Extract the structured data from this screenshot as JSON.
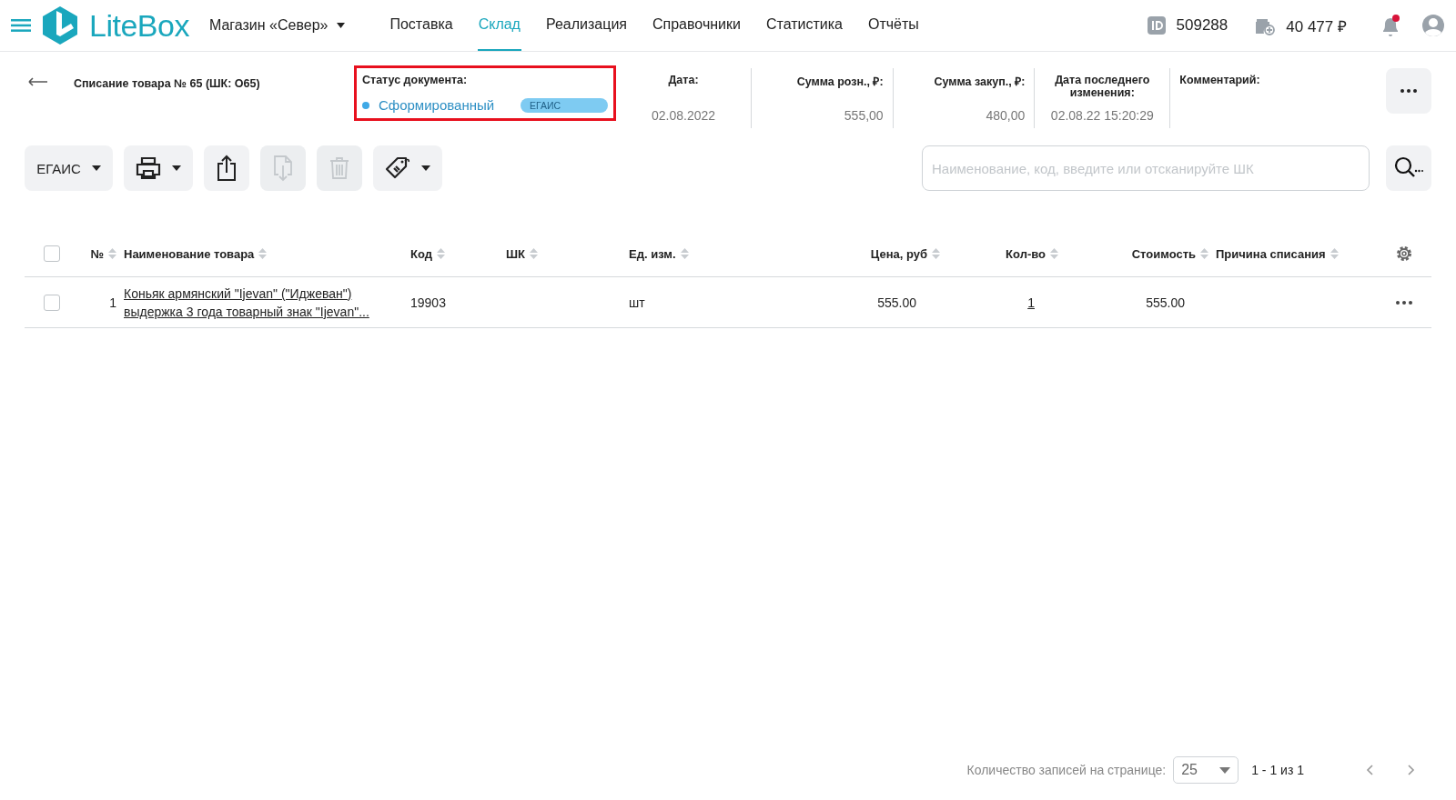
{
  "header": {
    "logo": "LiteBox",
    "store": "Магазин «Север»",
    "nav": [
      {
        "label": "Поставка",
        "selected": false
      },
      {
        "label": "Склад",
        "selected": true
      },
      {
        "label": "Реализация",
        "selected": false
      },
      {
        "label": "Справочники",
        "selected": false
      },
      {
        "label": "Статистика",
        "selected": false
      },
      {
        "label": "Отчёты",
        "selected": false
      }
    ],
    "account_id": "509288",
    "balance": "40 477 ₽",
    "has_notifications": true
  },
  "document": {
    "title": "Списание товара № 65 (ШК: О65)",
    "status_label": "Статус документа:",
    "status": "Сформированный",
    "status_tag": "ЕГАИС",
    "highlighted": true,
    "fields": [
      {
        "kind": "center",
        "label": "Дата:",
        "value": "02.08.2022"
      },
      {
        "kind": "right",
        "label": "Сумма розн., ₽:",
        "value": "555,00"
      },
      {
        "kind": "right",
        "label": "Сумма закуп., ₽:",
        "value": "480,00"
      },
      {
        "kind": "center",
        "label": "Дата последнего изменения:",
        "value": "02.08.22 15:20:29"
      },
      {
        "kind": "left",
        "label": "Комментарий:"
      }
    ]
  },
  "toolbar": {
    "menu_label": "ЕГАИС",
    "buttons": [
      {
        "kind": "print",
        "disabled": false
      },
      {
        "kind": "export",
        "disabled": false
      },
      {
        "kind": "import",
        "disabled": true
      },
      {
        "kind": "delete",
        "disabled": true
      },
      {
        "kind": "tag",
        "disabled": false
      }
    ],
    "search": {
      "placeholder": "Наименование, код, введите или отсканируйте ШК"
    }
  },
  "table": {
    "select_all_checked": false,
    "columns": [
      "№",
      "Наименование товара",
      "Код",
      "ШК",
      "Ед. изм.",
      "Цена, руб",
      "Кол-во",
      "Стоимость",
      "Причина списания"
    ],
    "rows": [
      {
        "checked": false,
        "number": "1",
        "name": "Коньяк армянский \"Ijevan\" (\"Иджеван\") выдержка 3 года товарный знак \"Ijevan\"...",
        "code": "19903",
        "unit": "шт",
        "price": "555.00",
        "quantity": "1",
        "cost": "555.00"
      }
    ]
  },
  "pagination": {
    "label": "Количество записей на странице:",
    "per_page": "25",
    "range": "1 - 1 из 1"
  }
}
